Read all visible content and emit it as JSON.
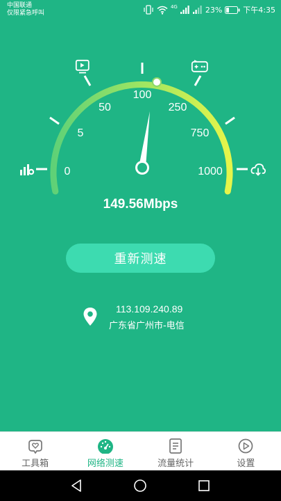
{
  "status_bar": {
    "carrier_line1": "中国联通",
    "carrier_line2": "仅限紧急呼叫",
    "signal_badge": "4G",
    "battery_percent": "23%",
    "time": "下午4:35"
  },
  "gauge": {
    "scale_labels": [
      "0",
      "5",
      "50",
      "100",
      "250",
      "750",
      "1000"
    ],
    "needle_value_mbps": 149.56,
    "icons": [
      "video-icon",
      "game-icon",
      "signal-bars-icon",
      "cloud-download-icon"
    ],
    "arc_colors": [
      "#7be07a",
      "#e4f44a"
    ]
  },
  "speed": {
    "value": "149.56Mbps"
  },
  "actions": {
    "retest_label": "重新测速"
  },
  "location": {
    "ip": "113.109.240.89",
    "isp": "广东省广州市-电信"
  },
  "tabs": [
    {
      "label": "工具箱",
      "icon": "heart-box-icon",
      "active": false
    },
    {
      "label": "网络测速",
      "icon": "speedometer-icon",
      "active": true
    },
    {
      "label": "流量统计",
      "icon": "document-icon",
      "active": false
    },
    {
      "label": "设置",
      "icon": "play-circle-icon",
      "active": false
    }
  ],
  "colors": {
    "background": "#1fb585",
    "button": "#3ddbb0",
    "accent": "#1fb585"
  }
}
